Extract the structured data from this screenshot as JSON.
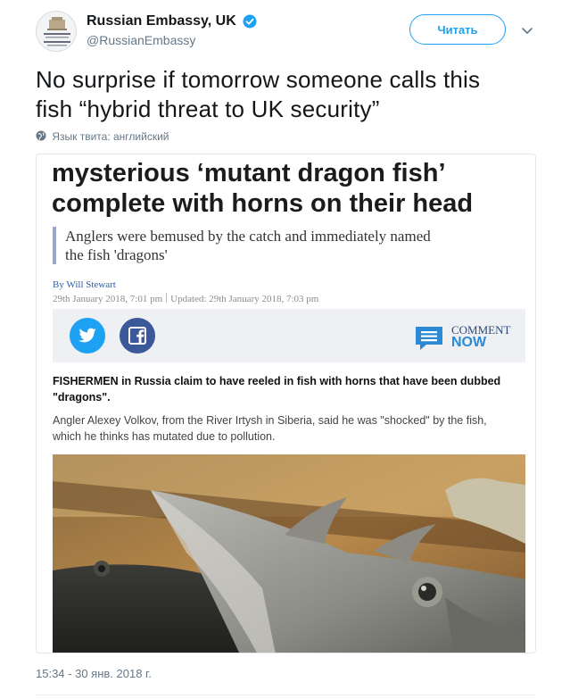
{
  "author": {
    "display_name": "Russian Embassy, UK",
    "handle": "@RussianEmbassy"
  },
  "follow_label": "Читать",
  "tweet": {
    "text_line1": "No surprise if tomorrow someone calls this",
    "text_line2": "fish “hybrid threat to UK security”",
    "language_note": "Язык твита: английский",
    "timestamp": "15:34 - 30 янв. 2018 г."
  },
  "article": {
    "headline_line1": "mysterious ‘mutant dragon fish’",
    "headline_line2": "complete with horns on their head",
    "standfirst_line1": "Anglers were bemused by the catch and immediately named",
    "standfirst_line2": "the fish 'dragons'",
    "byline": "By Will Stewart",
    "published": "29th January 2018, 7:01 pm",
    "updated": "Updated: 29th January 2018, 7:03 pm",
    "comment_label": "COMMENT",
    "comment_now": "NOW",
    "lead_line1": "FISHERMEN in Russia claim to have reeled in fish with horns that have been dubbed",
    "lead_line2": "\"dragons\".",
    "body_line1": "Angler Alexey Volkov, from the River Irtysh in Siberia, said he was \"shocked\" by the fish,",
    "body_line2": "which he thinks has mutated due to pollution."
  },
  "colors": {
    "accent": "#1da1f2",
    "twitter_blue": "#1da1f2",
    "facebook_blue": "#3b5998",
    "comment_blue": "#2b8ad3"
  }
}
